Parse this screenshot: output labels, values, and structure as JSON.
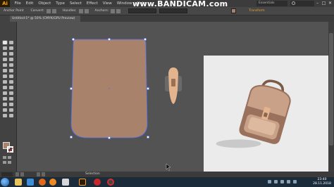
{
  "app": {
    "logo": "Ai",
    "window_controls": [
      "–",
      "□",
      "✕"
    ]
  },
  "menu": {
    "items": [
      "File",
      "Edit",
      "Object",
      "Type",
      "Select",
      "Effect",
      "View",
      "Window",
      "Help"
    ]
  },
  "watermark": "www.BANDICAM.com",
  "workspace": {
    "label": "Essentials"
  },
  "control_bar": {
    "anchor_label": "Anchor Point",
    "convert_label": "Convert:",
    "handles_label": "Handles:",
    "anchors_label": "Anchors:",
    "transform_label": "Transform"
  },
  "document": {
    "tab_title": "Untitled-1* @ 50% (CMYK/GPU Preview)"
  },
  "status": {
    "tool_name": "Selection"
  },
  "colors": {
    "bag_body": "#a9826c",
    "selection": "#4d6ef0",
    "artboard": "#ebebeb",
    "pasteboard": "#535353",
    "accent_fill": "#a9826c"
  },
  "taskbar": {
    "icons": [
      "start-icon",
      "explorer-icon",
      "browser-icon",
      "media-icon",
      "firefox-icon",
      "yandex-icon",
      "illustrator-icon",
      "bandicam-icon",
      "opera-icon"
    ],
    "clock_time": "23:40",
    "clock_date": "28.11.2018"
  }
}
